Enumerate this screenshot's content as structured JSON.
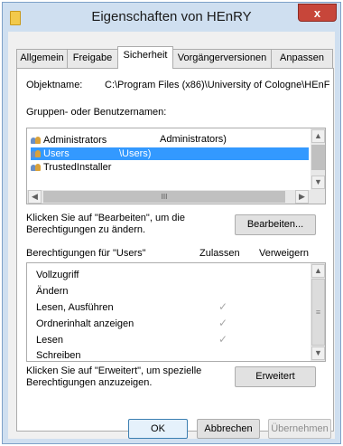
{
  "window": {
    "title": "Eigenschaften von HEnRY",
    "close_label": "x"
  },
  "tabs": [
    {
      "label": "Allgemein",
      "active": false
    },
    {
      "label": "Freigabe",
      "active": false
    },
    {
      "label": "Sicherheit",
      "active": true
    },
    {
      "label": "Vorgängerversionen",
      "active": false
    },
    {
      "label": "Anpassen",
      "active": false
    }
  ],
  "security": {
    "object_label": "Objektname:",
    "object_value": "C:\\Program Files (x86)\\University of Cologne\\HEnF",
    "groups_label": "Gruppen- oder Benutzernamen:",
    "groups": [
      {
        "name": "Administrators",
        "detail": "Administrators)",
        "selected": false
      },
      {
        "name": "Users",
        "detail": "\\Users)",
        "selected": true
      },
      {
        "name": "TrustedInstaller",
        "detail": "",
        "selected": false
      }
    ],
    "hscroll_thumb_glyph": "III",
    "edit_hint": "Klicken Sie auf \"Bearbeiten\", um die Berechtigungen zu ändern.",
    "edit_button": "Bearbeiten...",
    "perms_label": "Berechtigungen für \"Users\"",
    "allow_header": "Zulassen",
    "deny_header": "Verweigern",
    "permissions": [
      {
        "name": "Vollzugriff",
        "allow": false,
        "deny": false
      },
      {
        "name": "Ändern",
        "allow": false,
        "deny": false
      },
      {
        "name": "Lesen, Ausführen",
        "allow": true,
        "deny": false
      },
      {
        "name": "Ordnerinhalt anzeigen",
        "allow": true,
        "deny": false
      },
      {
        "name": "Lesen",
        "allow": true,
        "deny": false
      },
      {
        "name": "Schreiben",
        "allow": false,
        "deny": false
      }
    ],
    "check_glyph": "✓",
    "advanced_hint": "Klicken Sie auf \"Erweitert\", um spezielle Berechtigungen anzuzeigen.",
    "advanced_button": "Erweitert"
  },
  "buttons": {
    "ok": "OK",
    "cancel": "Abbrechen",
    "apply": "Übernehmen"
  }
}
